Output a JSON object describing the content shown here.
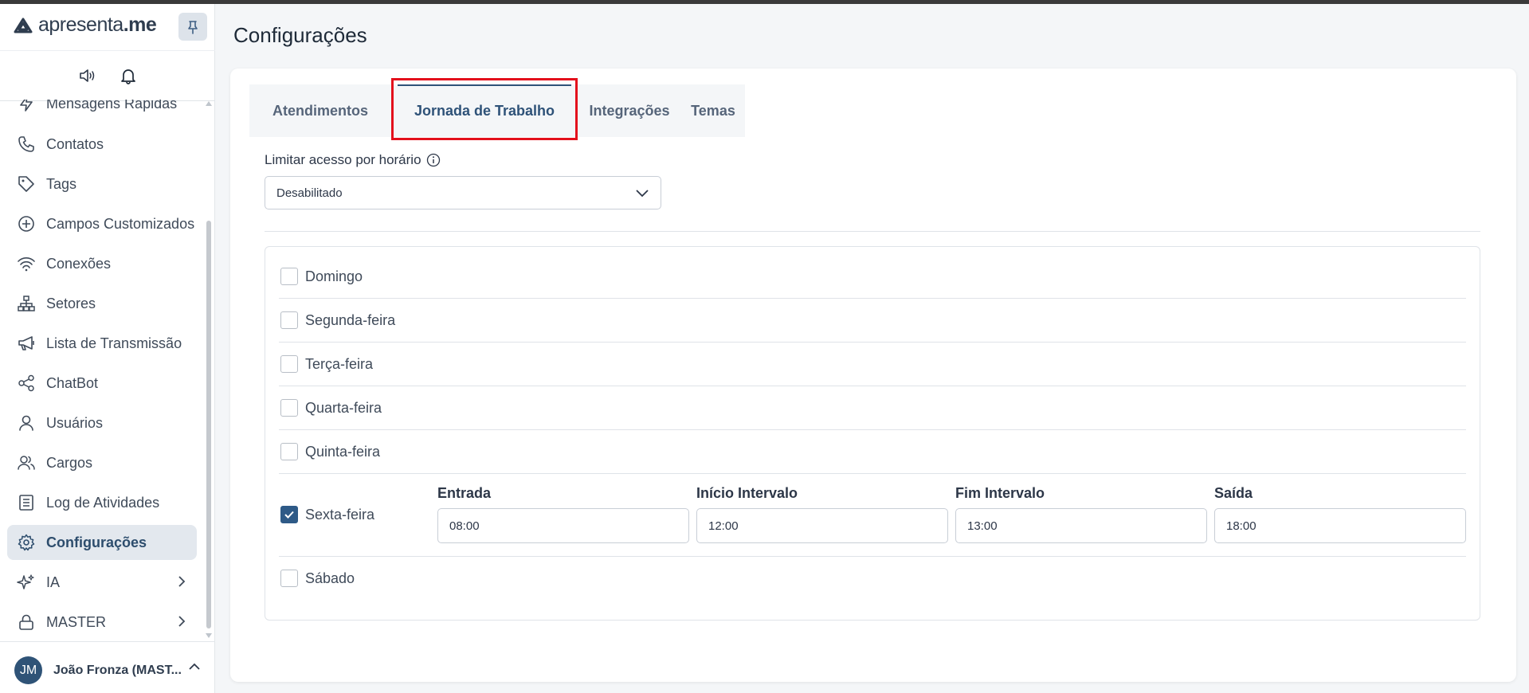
{
  "app": {
    "logo_text_light": "apresenta",
    "logo_text_bold": ".me",
    "pin_icon": "pin-icon"
  },
  "sidebar": {
    "items": [
      {
        "label": "Mensagens Rápidas",
        "icon": "lightning-icon"
      },
      {
        "label": "Contatos",
        "icon": "phone-icon"
      },
      {
        "label": "Tags",
        "icon": "tag-icon"
      },
      {
        "label": "Campos Customizados",
        "icon": "plus-circle-icon"
      },
      {
        "label": "Conexões",
        "icon": "wifi-icon"
      },
      {
        "label": "Setores",
        "icon": "sitemap-icon"
      },
      {
        "label": "Lista de Transmissão",
        "icon": "megaphone-icon"
      },
      {
        "label": "ChatBot",
        "icon": "share-icon"
      },
      {
        "label": "Usuários",
        "icon": "user-icon"
      },
      {
        "label": "Cargos",
        "icon": "users-icon"
      },
      {
        "label": "Log de Atividades",
        "icon": "log-icon"
      },
      {
        "label": "Configurações",
        "icon": "gear-icon",
        "active": true
      },
      {
        "label": "IA",
        "icon": "sparkle-icon",
        "has_submenu": true
      },
      {
        "label": "MASTER",
        "icon": "lock-icon",
        "has_submenu": true
      }
    ]
  },
  "user": {
    "initials": "JM",
    "name": "João Fronza (MAST..."
  },
  "page": {
    "title": "Configurações"
  },
  "tabs": [
    {
      "label": "Atendimentos",
      "active": false
    },
    {
      "label": "Jornada de Trabalho",
      "active": true
    },
    {
      "label": "Integrações",
      "active": false
    },
    {
      "label": "Temas",
      "active": false
    }
  ],
  "access_limit": {
    "label": "Limitar acesso por horário",
    "value": "Desabilitado"
  },
  "time_labels": {
    "entrada": "Entrada",
    "inicio_intervalo": "Início Intervalo",
    "fim_intervalo": "Fim Intervalo",
    "saida": "Saída"
  },
  "days": [
    {
      "name": "Domingo",
      "checked": false
    },
    {
      "name": "Segunda-feira",
      "checked": false
    },
    {
      "name": "Terça-feira",
      "checked": false
    },
    {
      "name": "Quarta-feira",
      "checked": false
    },
    {
      "name": "Quinta-feira",
      "checked": false
    },
    {
      "name": "Sexta-feira",
      "checked": true,
      "entrada": "08:00",
      "inicio_intervalo": "12:00",
      "fim_intervalo": "13:00",
      "saida": "18:00"
    },
    {
      "name": "Sábado",
      "checked": false
    }
  ],
  "colors": {
    "accent": "#2e5278",
    "highlight_box": "#e3101c",
    "checkbox_checked": "#2e5a87"
  }
}
